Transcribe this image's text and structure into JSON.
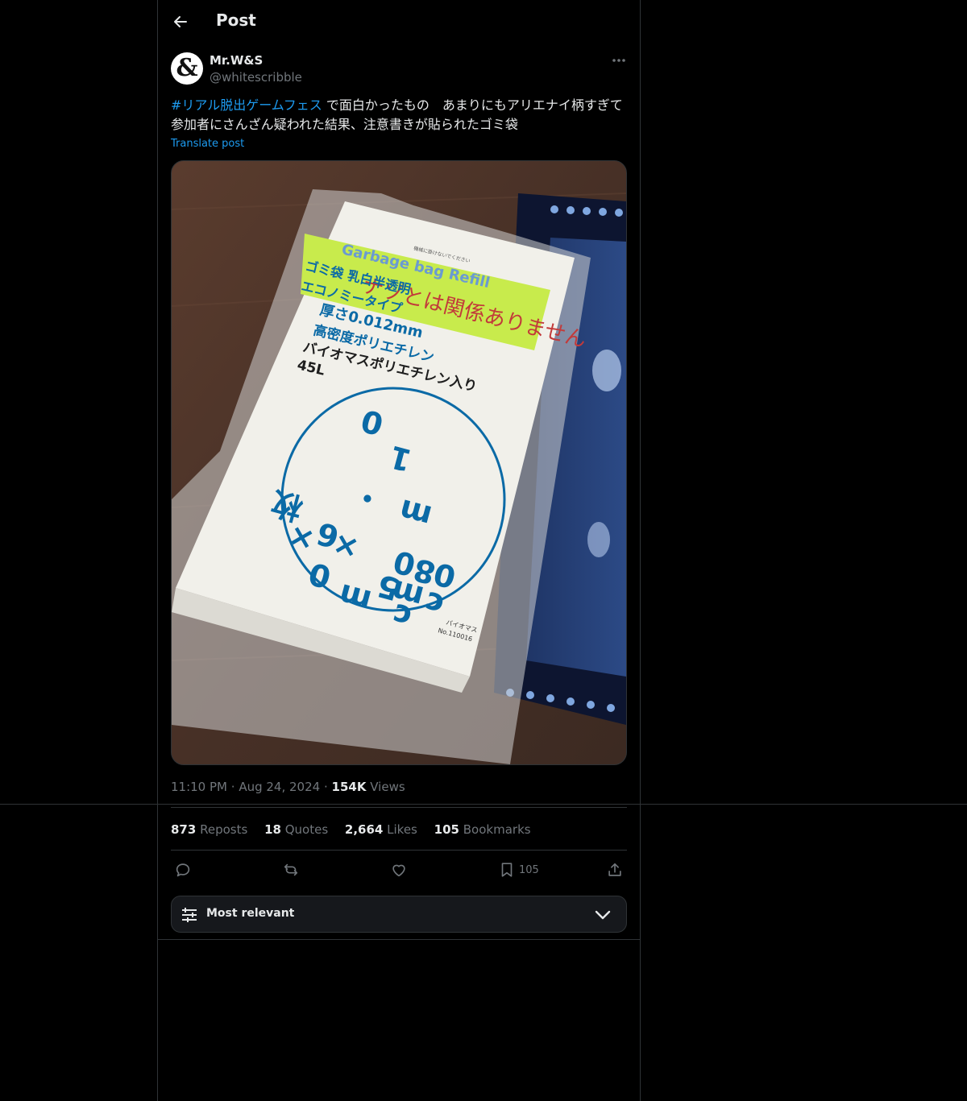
{
  "header": {
    "title": "Post"
  },
  "post": {
    "author_name": "Mr.W&S",
    "author_handle": "@whitescribble",
    "avatar_glyph": "&",
    "hashtag": "#リアル脱出ゲームフェス",
    "body": " で面白かったもの　あまりにもアリエナイ柄すぎて参加者にさんざん疑われた結果、注意書きが貼られたゴミ袋",
    "translate_label": "Translate post",
    "time": "11:10 PM",
    "separator": "·",
    "date": "Aug 24, 2024",
    "views_count": "154K",
    "views_label": "Views"
  },
  "image": {
    "label_en": "Garbage bag Refill",
    "sticker_note": "ナゾとは関係ありません",
    "spec_lines": [
      "ゴミ袋 乳白半透明",
      "エコノミータイプ",
      "厚さ0.012mm",
      "高密度ポリエチレン",
      "バイオマスポリエチレン入り",
      "45L"
    ],
    "notice": "機械に掛けないでください",
    "circle_chars": [
      "0",
      "1",
      "m",
      "・",
      "0",
      "8",
      "0",
      "c",
      "m",
      "×",
      "6",
      "5",
      "c",
      "m",
      "×",
      "0",
      "枚"
    ],
    "biomass_label": "バイオマス",
    "product_no": "No.110016"
  },
  "stats": [
    {
      "count": "873",
      "label": "Reposts"
    },
    {
      "count": "18",
      "label": "Quotes"
    },
    {
      "count": "2,664",
      "label": "Likes"
    },
    {
      "count": "105",
      "label": "Bookmarks"
    }
  ],
  "actions": {
    "reply_icon": "reply-icon",
    "repost_icon": "repost-icon",
    "like_icon": "heart-icon",
    "bookmark_icon": "bookmark-icon",
    "bookmark_count": "105",
    "share_icon": "share-icon"
  },
  "sort": {
    "label": "Most relevant"
  },
  "colors": {
    "accent": "#1d9bf0",
    "background": "#000000",
    "border": "#2f3336",
    "muted": "#71767b",
    "text": "#e7e9ea"
  }
}
